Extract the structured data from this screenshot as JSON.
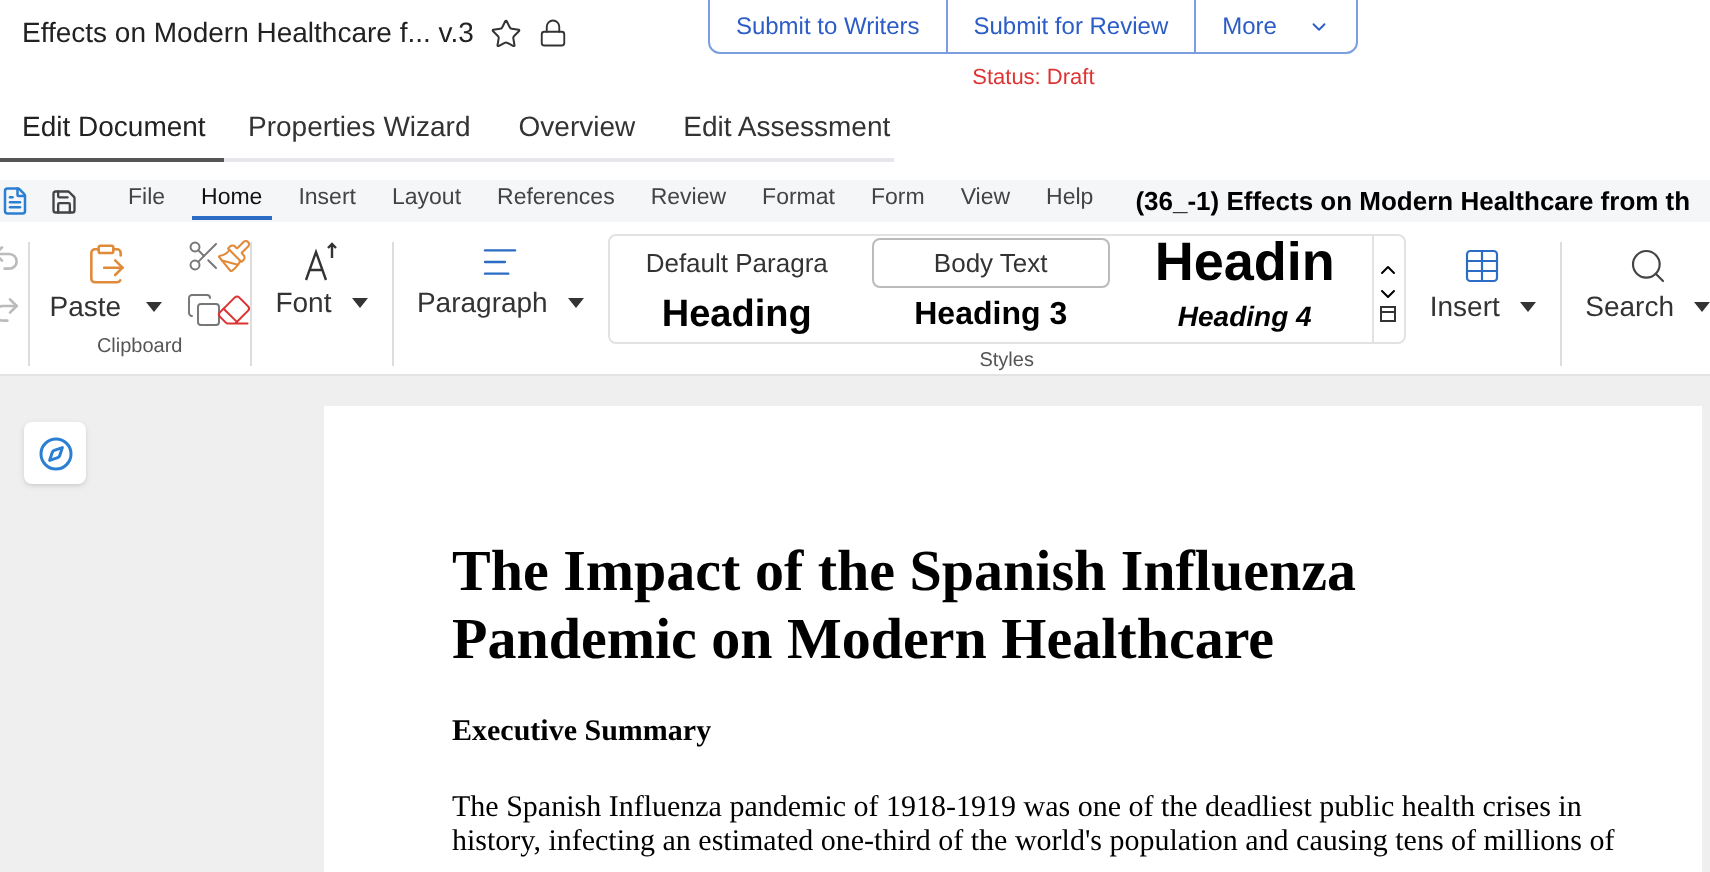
{
  "header": {
    "title": "Effects on Modern Healthcare f... v.3",
    "actions": [
      {
        "label": "Submit to Writers",
        "kind": "button"
      },
      {
        "label": "Submit for Review",
        "kind": "button"
      },
      {
        "label": "More",
        "kind": "dropdown"
      }
    ],
    "status": "Status: Draft"
  },
  "tabs": [
    {
      "label": "Edit Document",
      "selected": true
    },
    {
      "label": "Properties Wizard",
      "selected": false
    },
    {
      "label": "Overview",
      "selected": false
    },
    {
      "label": "Edit Assessment",
      "selected": false
    }
  ],
  "menu": {
    "items": [
      {
        "label": "File",
        "selected": false
      },
      {
        "label": "Home",
        "selected": true
      },
      {
        "label": "Insert",
        "selected": false
      },
      {
        "label": "Layout",
        "selected": false
      },
      {
        "label": "References",
        "selected": false
      },
      {
        "label": "Review",
        "selected": false
      },
      {
        "label": "Format",
        "selected": false
      },
      {
        "label": "Form",
        "selected": false
      },
      {
        "label": "View",
        "selected": false
      },
      {
        "label": "Help",
        "selected": false
      }
    ],
    "document_title": "(36_-1) Effects on Modern Healthcare from th"
  },
  "ribbon": {
    "paste": "Paste",
    "clipboard_label": "Clipboard",
    "font": "Font",
    "paragraph": "Paragraph",
    "styles_label": "Styles",
    "insert": "Insert",
    "search": "Search",
    "styles": [
      {
        "label": "Default Paragra",
        "kind": "normal",
        "selected": false
      },
      {
        "label": "Body Text",
        "kind": "body",
        "selected": true
      },
      {
        "label": "Headin",
        "kind": "heading1",
        "selected": false
      },
      {
        "label": "Heading",
        "kind": "heading2",
        "selected": false
      },
      {
        "label": "Heading 3",
        "kind": "heading3",
        "selected": false
      },
      {
        "label": "Heading 4",
        "kind": "heading4",
        "selected": false
      }
    ]
  },
  "document": {
    "title": "The Impact of the Spanish Influenza Pandemic on Modern Healthcare",
    "heading": "Executive Summary",
    "paragraph": "The Spanish Influenza pandemic of 1918-1919 was one of the deadliest public health crises in history, infecting an estimated one-third of the world's population and causing tens of millions of"
  }
}
